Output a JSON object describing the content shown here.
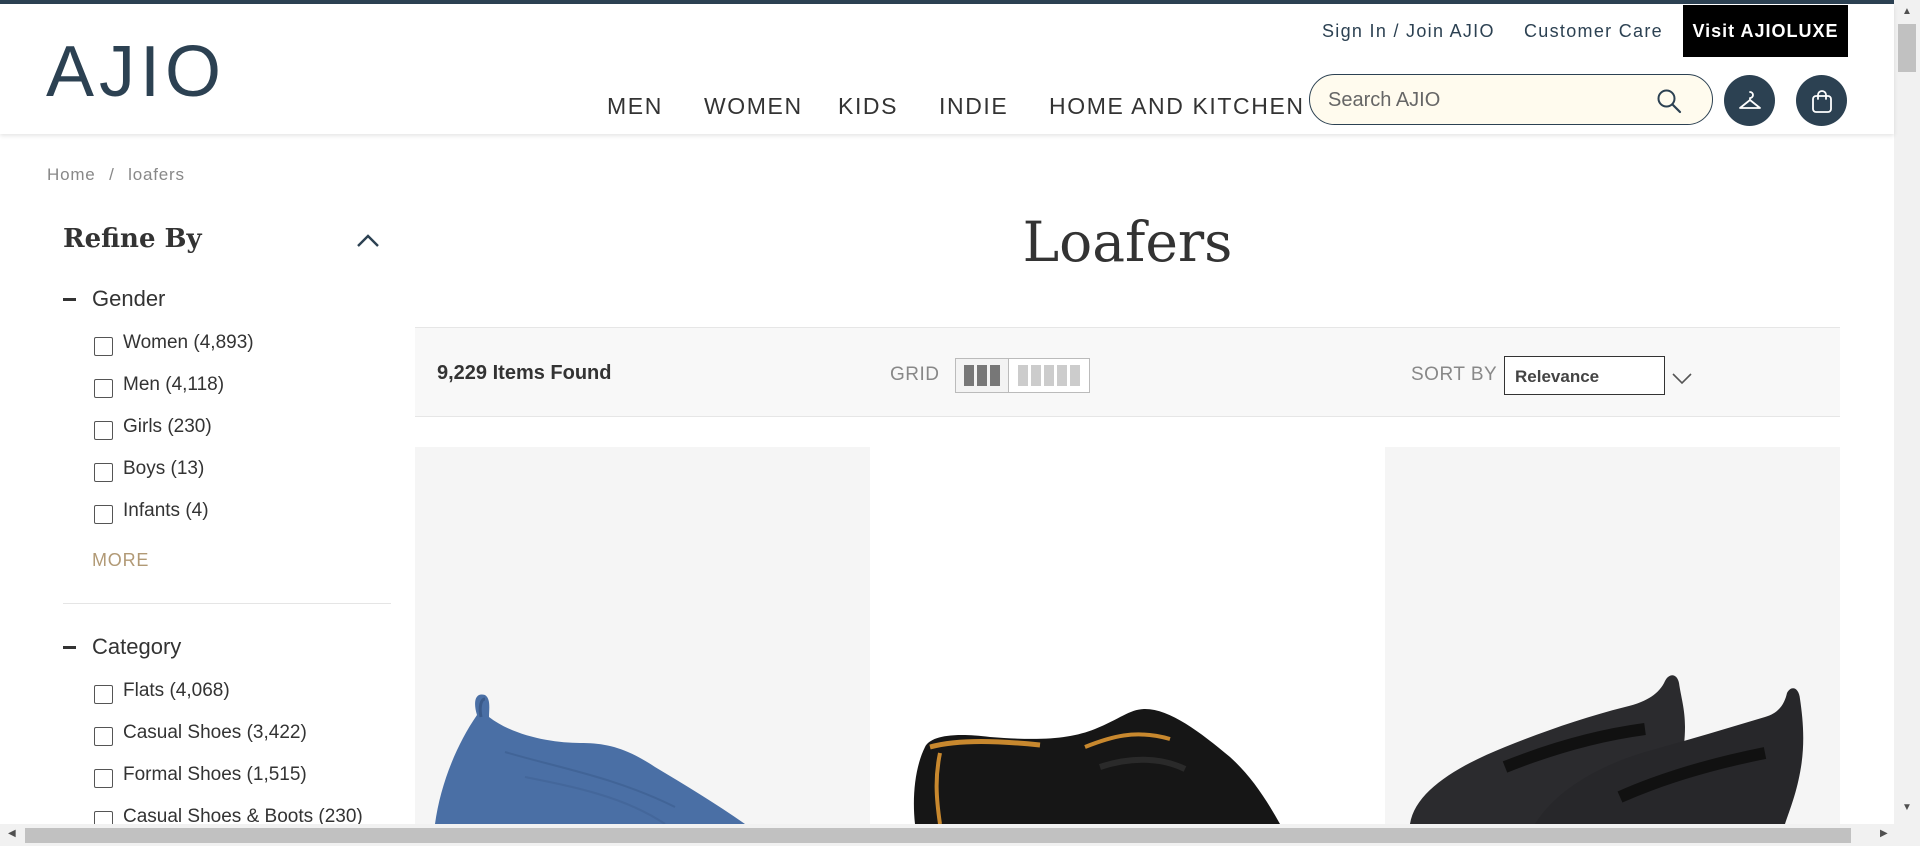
{
  "header": {
    "logo": "AJIO",
    "signin": "Sign In / Join AJIO",
    "customer_care": "Customer Care",
    "visit_luxe": "Visit AJIOLUXE",
    "nav": [
      "MEN",
      "WOMEN",
      "KIDS",
      "INDIE",
      "HOME AND KITCHEN"
    ],
    "search_placeholder": "Search AJIO"
  },
  "breadcrumb": {
    "home": "Home",
    "separator": "/",
    "current": "loafers"
  },
  "sidebar": {
    "title": "Refine By",
    "gender": {
      "heading": "Gender",
      "options": [
        "Women (4,893)",
        "Men (4,118)",
        "Girls (230)",
        "Boys (13)",
        "Infants (4)"
      ],
      "more": "MORE"
    },
    "category": {
      "heading": "Category",
      "options": [
        "Flats (4,068)",
        "Casual Shoes (3,422)",
        "Formal Shoes (1,515)",
        "Casual Shoes & Boots (230)"
      ]
    }
  },
  "listing": {
    "title": "Loafers",
    "items_found": "9,229 Items Found",
    "grid_label": "GRID",
    "sort_label": "SORT BY",
    "sort_value": "Relevance"
  },
  "colors": {
    "brand": "#2c4152",
    "search_bg": "#fffbee",
    "more_link": "#b19975"
  },
  "products": [
    {
      "icon": "blue-knit-shoe-image"
    },
    {
      "icon": "black-loafer-image"
    },
    {
      "icon": "black-slip-on-image"
    }
  ]
}
